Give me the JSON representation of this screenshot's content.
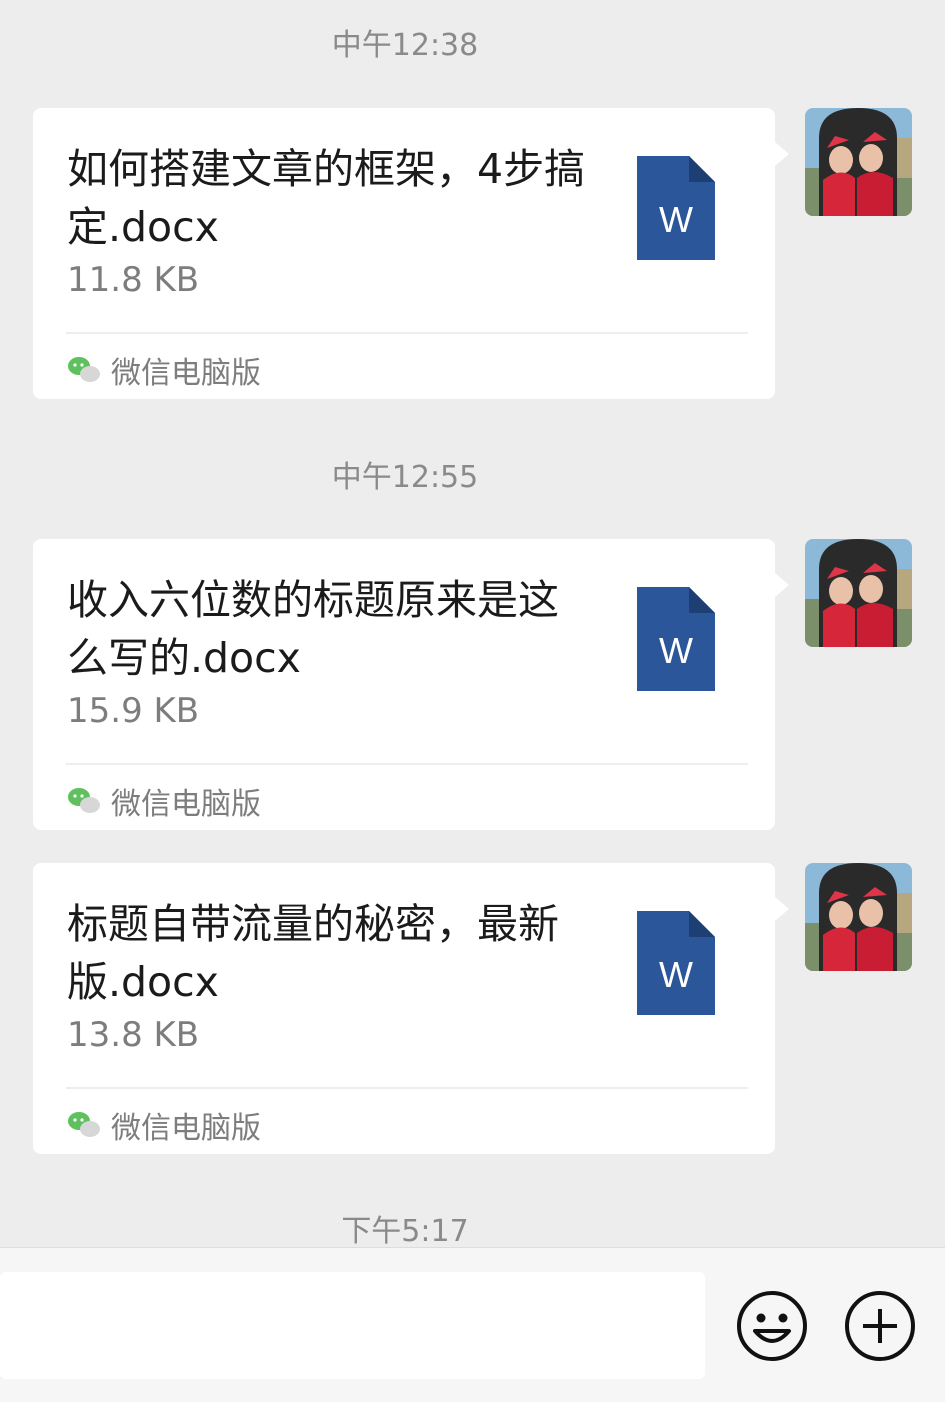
{
  "messages": [
    {
      "time": "中午12:38",
      "file_name": "如何搭建文章的框架，4步搞定.docx",
      "file_size": "11.8 KB",
      "source": "微信电脑版"
    },
    {
      "time": "中午12:55",
      "file_name": "收入六位数的标题原来是这么写的.docx",
      "file_size": "15.9 KB",
      "source": "微信电脑版"
    },
    {
      "time": "",
      "file_name": "标题自带流量的秘密，最新版.docx",
      "file_size": "13.8 KB",
      "source": "微信电脑版"
    }
  ],
  "last_time": "下午5:17",
  "icons": {
    "file_type": "word-document-icon",
    "file_letter": "W",
    "source_logo": "wechat-logo-icon",
    "emoji": "emoji-smile-icon",
    "more": "plus-circle-icon"
  },
  "colors": {
    "word_blue": "#2b579a",
    "wechat_green": "#07c160",
    "background": "#ededed"
  }
}
